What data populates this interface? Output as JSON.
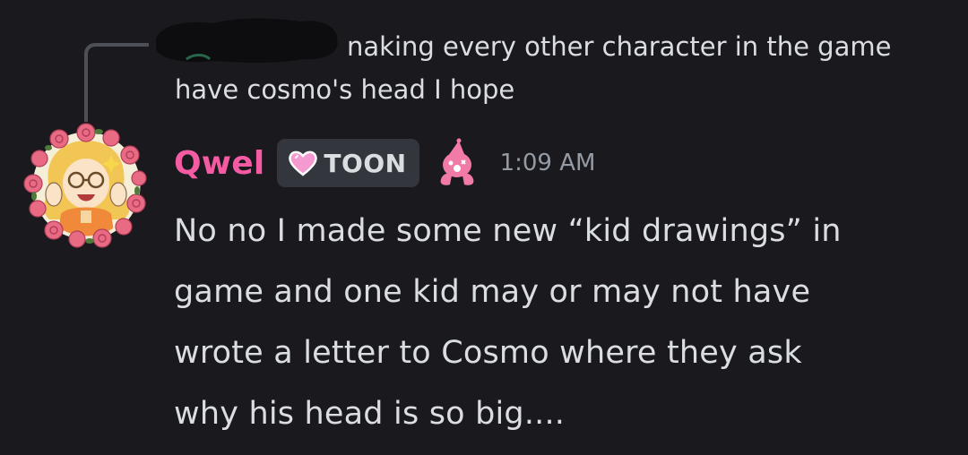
{
  "reply": {
    "author": "",
    "line_1": "naking every other character in the game",
    "line_2": "have cosmo's head I hope"
  },
  "message": {
    "username": "Qwel",
    "username_color": "#f45ba3",
    "tag": {
      "label": "TOON",
      "icon": "pink-heart-icon"
    },
    "role_icon": "pink-clown-icon",
    "timestamp": "1:09 AM",
    "content_lines": [
      "No no I made some new “kid drawings” in",
      "game and one kid may or may not have",
      "wrote a letter to Cosmo where they ask",
      "why his head is so big...."
    ]
  },
  "colors": {
    "background": "#1a1a1e",
    "text": "#dbdee1",
    "muted": "#949ba4",
    "tag_bg": "#34363d"
  }
}
